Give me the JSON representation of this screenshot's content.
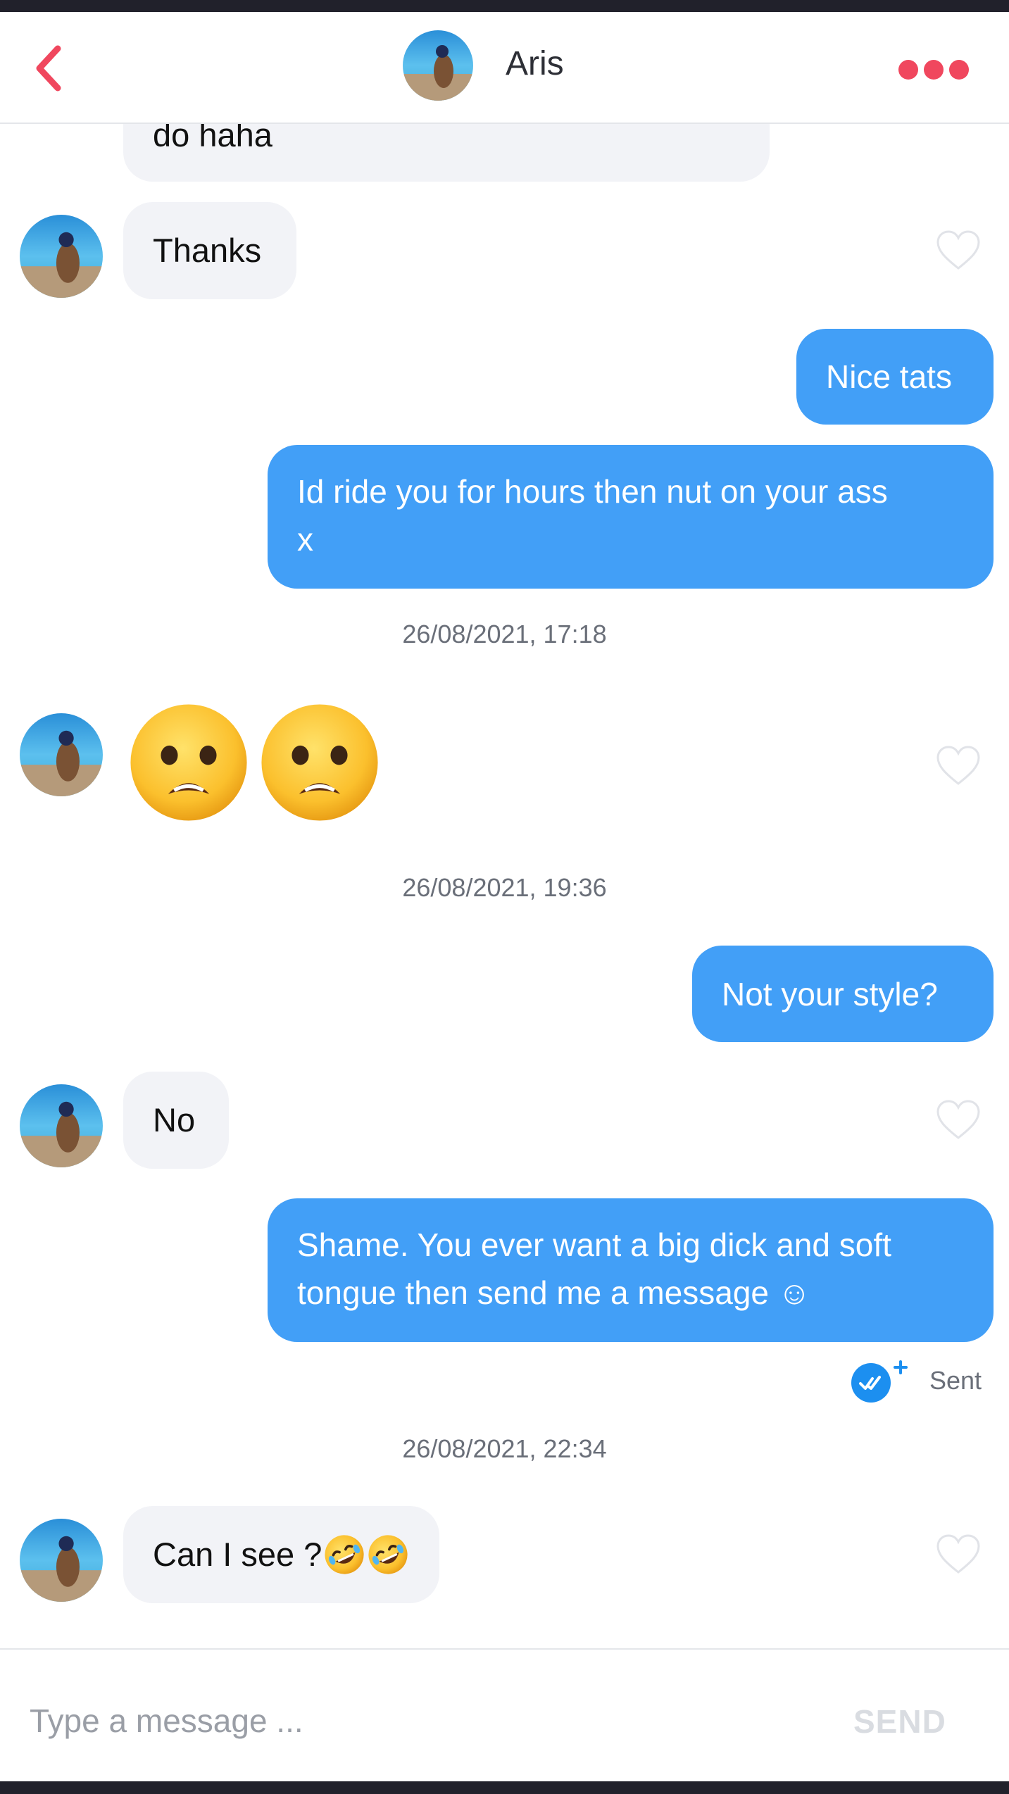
{
  "header": {
    "back_icon": "chevron-left-icon",
    "contact_name": "Aris",
    "more_icon": "three-dots-icon"
  },
  "messages": {
    "m0": {
      "text": "do haha"
    },
    "m1": {
      "text": "Thanks"
    },
    "m2": {
      "text": "Nice tats"
    },
    "m3": {
      "line1": "Id ride you for hours then nut on your ass",
      "line2": "x"
    },
    "m4": {
      "emoji": [
        "anguished-face",
        "anguished-face"
      ]
    },
    "m5": {
      "text": "Not your style?"
    },
    "m6": {
      "text": "No"
    },
    "m7": {
      "line1": "Shame. You ever want a big dick and soft",
      "line2": "tongue then send me a message ☺"
    },
    "m8": {
      "text": "Can I see ?",
      "emoji": [
        "rolling-on-floor-laughing",
        "rolling-on-floor-laughing"
      ]
    }
  },
  "timestamps": [
    "26/08/2021, 17:18",
    "26/08/2021, 19:36",
    "26/08/2021, 22:34"
  ],
  "status": {
    "label": "Sent",
    "icon": "double-check-icon"
  },
  "composer": {
    "placeholder": "Type a message ...",
    "send_label": "SEND"
  },
  "colors": {
    "accent": "#f0475e",
    "outgoing_bubble": "#429ff7",
    "incoming_bubble": "#f2f3f7",
    "send_disabled": "#d9dce1",
    "status_icon": "#1c8ff0"
  }
}
